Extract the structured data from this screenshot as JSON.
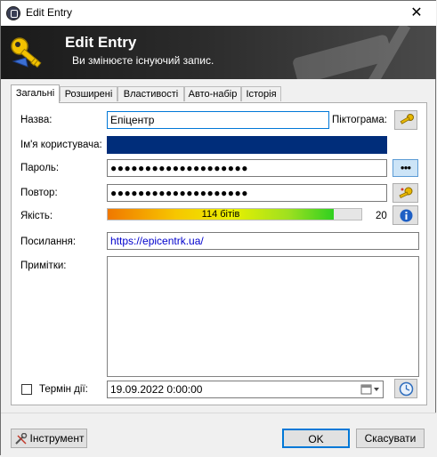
{
  "window": {
    "title": "Edit Entry",
    "close_glyph": "✕"
  },
  "banner": {
    "title": "Edit Entry",
    "subtitle": "Ви змінюєте існуючий запис."
  },
  "tabs": [
    {
      "label": "Загальні",
      "active": true
    },
    {
      "label": "Розширені"
    },
    {
      "label": "Властивості"
    },
    {
      "label": "Авто-набір"
    },
    {
      "label": "Історія"
    }
  ],
  "form": {
    "title_label": "Назва:",
    "title_value": "Епіцентр",
    "icon_label": "Піктограма:",
    "username_label": "Ім'я користувача:",
    "username_value": "",
    "password_label": "Пароль:",
    "password_value": "●●●●●●●●●●●●●●●●●●●●",
    "repeat_label": "Повтор:",
    "repeat_value": "●●●●●●●●●●●●●●●●●●●●",
    "quality_label": "Якість:",
    "quality_text": "114 бітів",
    "quality_fraction": 0.89,
    "quality_count": "20 c",
    "url_label": "Посилання:",
    "url_value": "https://epicentrk.ua/",
    "notes_label": "Примітки:",
    "notes_value": "",
    "expiry_label": "Термін дії:",
    "expiry_checked": false,
    "expiry_value": "19.09.2022   0:00:00",
    "show_password_glyph": "●●●"
  },
  "footer": {
    "tools_label": "Інструмент",
    "ok_label": "OK",
    "cancel_label": "Скасувати"
  },
  "colors": {
    "username_fill": "#002d7a",
    "focus_border": "#0078d7",
    "url_text": "#0000cc",
    "ok_border": "#0078d7"
  },
  "icons": [
    "app-lock-icon",
    "close-icon",
    "key-icon",
    "entry-icon-key",
    "generator-icon",
    "info-icon",
    "calendar-icon",
    "clock-icon",
    "tools-icon"
  ]
}
